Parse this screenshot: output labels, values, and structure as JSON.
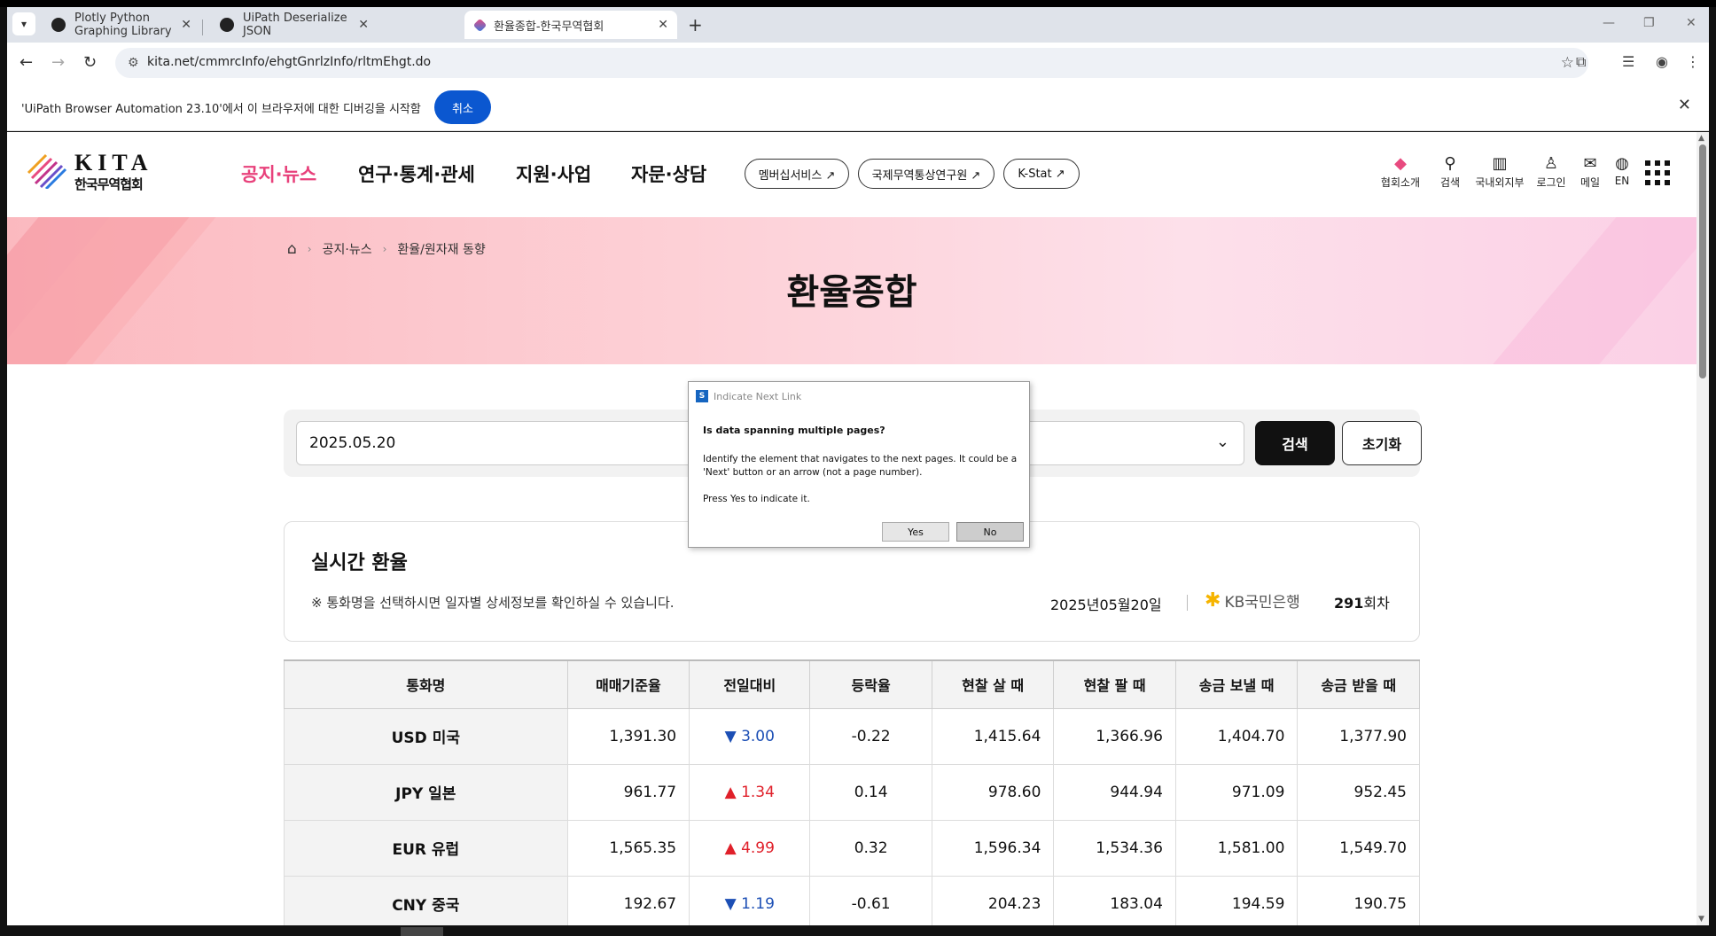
{
  "browser": {
    "tabs": [
      {
        "title": "Plotly Python Graphing Library",
        "active": false
      },
      {
        "title": "UiPath Deserialize JSON",
        "active": false
      },
      {
        "title": "환율종합-한국무역협회",
        "active": true
      }
    ],
    "url": "kita.net/cmmrcInfo/ehgtGnrlzInfo/rltmEhgt.do",
    "infobar": {
      "text": "'UiPath Browser Automation 23.10'에서 이 브라우저에 대한 디버깅을 시작함",
      "cancel_label": "취소"
    }
  },
  "site": {
    "logo": {
      "en": "KITA",
      "kr": "한국무역협회"
    },
    "nav": [
      "공지·뉴스",
      "연구·통계·관세",
      "지원·사업",
      "자문·상담"
    ],
    "pills": [
      "멤버십서비스 ↗",
      "국제무역통상연구원 ↗",
      "K-Stat ↗"
    ],
    "utils": [
      "협회소개",
      "검색",
      "국내외지부",
      "로그인",
      "메일",
      "EN"
    ]
  },
  "hero": {
    "breadcrumb": [
      "공지·뉴스",
      "환율/원자재 동향"
    ],
    "title": "환율종합"
  },
  "search": {
    "date_value": "2025.05.20",
    "search_label": "검색",
    "reset_label": "초기화"
  },
  "realtime": {
    "title": "실시간 환율",
    "note": "※ 통화명을 선택하시면 일자별 상세정보를 확인하실 수 있습니다.",
    "date": "2025년05월20일",
    "bank": "KB국민은행",
    "round_num": "291",
    "round_unit": "회차"
  },
  "table": {
    "headers": [
      "통화명",
      "매매기준율",
      "전일대비",
      "등락율",
      "현찰 살 때",
      "현찰 팔 때",
      "송금 보낼 때",
      "송금 받을 때"
    ],
    "rows": [
      {
        "currency": "USD 미국",
        "base": "1,391.30",
        "dir": "down",
        "change": "3.00",
        "rate": "-0.22",
        "cash_buy": "1,415.64",
        "cash_sell": "1,366.96",
        "send": "1,404.70",
        "receive": "1,377.90"
      },
      {
        "currency": "JPY 일본",
        "base": "961.77",
        "dir": "up",
        "change": "1.34",
        "rate": "0.14",
        "cash_buy": "978.60",
        "cash_sell": "944.94",
        "send": "971.09",
        "receive": "952.45"
      },
      {
        "currency": "EUR 유럽",
        "base": "1,565.35",
        "dir": "up",
        "change": "4.99",
        "rate": "0.32",
        "cash_buy": "1,596.34",
        "cash_sell": "1,534.36",
        "send": "1,581.00",
        "receive": "1,549.70"
      },
      {
        "currency": "CNY 중국",
        "base": "192.67",
        "dir": "down",
        "change": "1.19",
        "rate": "-0.61",
        "cash_buy": "204.23",
        "cash_sell": "183.04",
        "send": "194.59",
        "receive": "190.75"
      }
    ]
  },
  "dialog": {
    "title": "Indicate Next Link",
    "question": "Is data spanning multiple pages?",
    "body": "Identify the element that navigates to the next pages. It could be a 'Next' button or an arrow (not a page number).",
    "press": "Press Yes to indicate it.",
    "yes_label": "Yes",
    "no_label": "No"
  },
  "colors": {
    "accent_pink": "#e8417b",
    "chrome_blue": "#0b57d0",
    "down": "#1c4fb5",
    "up": "#e0202a"
  }
}
